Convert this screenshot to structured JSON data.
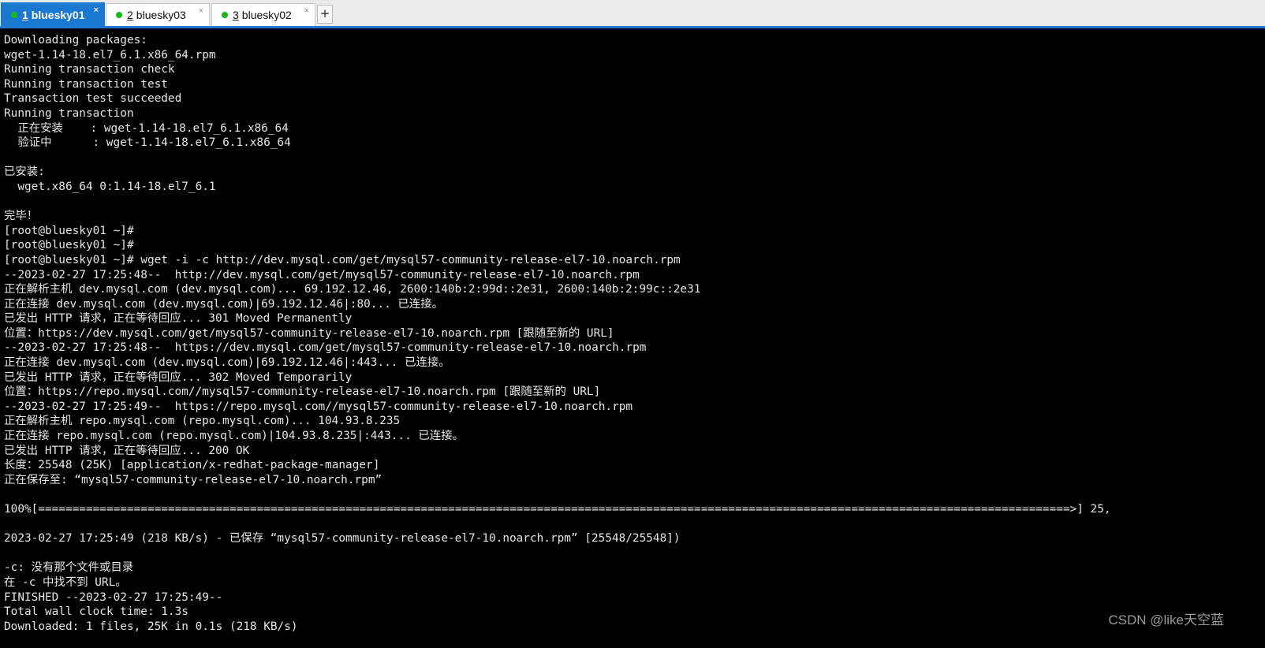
{
  "tabs": [
    {
      "number": "1",
      "label": "bluesky01",
      "active": true
    },
    {
      "number": "2",
      "label": "bluesky03",
      "active": false
    },
    {
      "number": "3",
      "label": "bluesky02",
      "active": false
    }
  ],
  "tab_close_glyph": "×",
  "new_tab_glyph": "+",
  "colors": {
    "tab_active": "#1b78d0",
    "status_dot": "#18b818",
    "terminal_bg": "#000000",
    "terminal_fg": "#e6e6e6"
  },
  "terminal": {
    "lines": [
      "Downloading packages:",
      "wget-1.14-18.el7_6.1.x86_64.rpm",
      "Running transaction check",
      "Running transaction test",
      "Transaction test succeeded",
      "Running transaction",
      "  正在安装    : wget-1.14-18.el7_6.1.x86_64",
      "  验证中      : wget-1.14-18.el7_6.1.x86_64",
      "",
      "已安装:",
      "  wget.x86_64 0:1.14-18.el7_6.1",
      "",
      "完毕！",
      "[root@bluesky01 ~]#",
      "[root@bluesky01 ~]#",
      "[root@bluesky01 ~]# wget -i -c http://dev.mysql.com/get/mysql57-community-release-el7-10.noarch.rpm",
      "--2023-02-27 17:25:48--  http://dev.mysql.com/get/mysql57-community-release-el7-10.noarch.rpm",
      "正在解析主机 dev.mysql.com (dev.mysql.com)... 69.192.12.46, 2600:140b:2:99d::2e31, 2600:140b:2:99c::2e31",
      "正在连接 dev.mysql.com (dev.mysql.com)|69.192.12.46|:80... 已连接。",
      "已发出 HTTP 请求，正在等待回应... 301 Moved Permanently",
      "位置：https://dev.mysql.com/get/mysql57-community-release-el7-10.noarch.rpm [跟随至新的 URL]",
      "--2023-02-27 17:25:48--  https://dev.mysql.com/get/mysql57-community-release-el7-10.noarch.rpm",
      "正在连接 dev.mysql.com (dev.mysql.com)|69.192.12.46|:443... 已连接。",
      "已发出 HTTP 请求，正在等待回应... 302 Moved Temporarily",
      "位置：https://repo.mysql.com//mysql57-community-release-el7-10.noarch.rpm [跟随至新的 URL]",
      "--2023-02-27 17:25:49--  https://repo.mysql.com//mysql57-community-release-el7-10.noarch.rpm",
      "正在解析主机 repo.mysql.com (repo.mysql.com)... 104.93.8.235",
      "正在连接 repo.mysql.com (repo.mysql.com)|104.93.8.235|:443... 已连接。",
      "已发出 HTTP 请求，正在等待回应... 200 OK",
      "长度：25548 (25K) [application/x-redhat-package-manager]",
      "正在保存至: “mysql57-community-release-el7-10.noarch.rpm”",
      "",
      "100%[=======================================================================================================================================================>] 25,",
      "",
      "2023-02-27 17:25:49 (218 KB/s) - 已保存 “mysql57-community-release-el7-10.noarch.rpm” [25548/25548])",
      "",
      "-c: 没有那个文件或目录",
      "在 -c 中找不到 URL。",
      "FINISHED --2023-02-27 17:25:49--",
      "Total wall clock time: 1.3s",
      "Downloaded: 1 files, 25K in 0.1s (218 KB/s)"
    ]
  },
  "watermark": "CSDN @like天空蓝"
}
